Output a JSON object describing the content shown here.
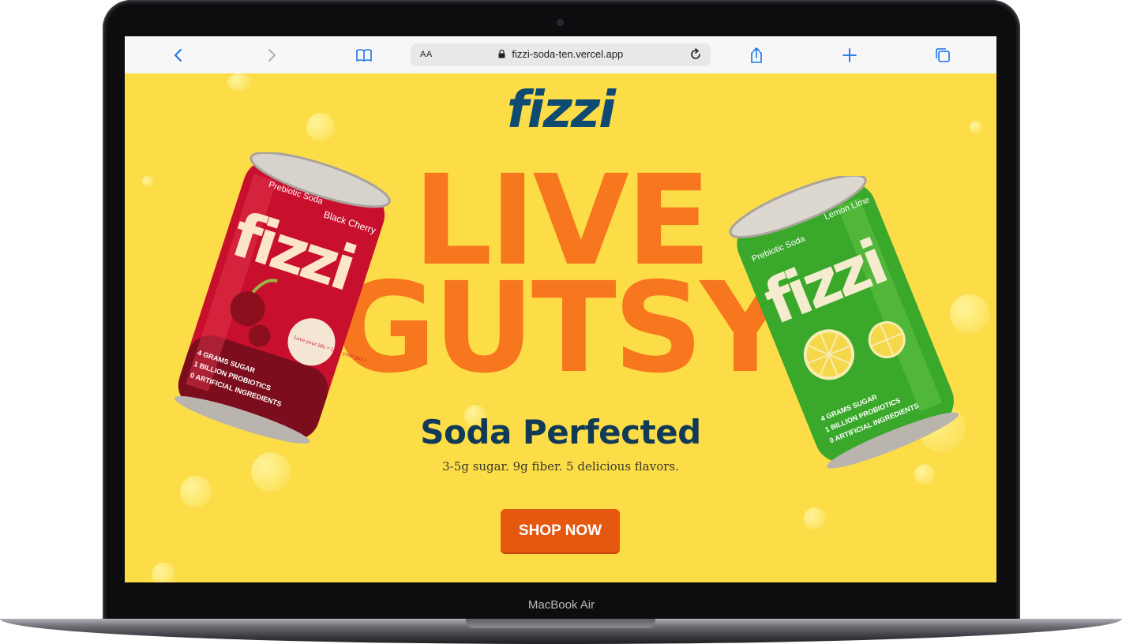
{
  "device": {
    "model_label": "MacBook Air"
  },
  "browser": {
    "text_size_label": "AA",
    "url": "fizzi-soda-ten.vercel.app",
    "icons": [
      "back-icon",
      "forward-icon",
      "bookmarks-icon",
      "lock-icon",
      "reload-icon",
      "share-icon",
      "new-tab-icon",
      "tabs-icon"
    ]
  },
  "hero": {
    "logo": "fizzi",
    "headline_line1": "LIVE",
    "headline_line2": "GUTSY",
    "subtitle": "Soda Perfected",
    "tagline": "3-5g sugar. 9g fiber. 5 delicious flavors.",
    "cta": "SHOP NOW"
  },
  "cans": {
    "left": {
      "brand": "fizzi",
      "label": "Prebiotic Soda",
      "flavor": "Black Cherry",
      "stamp": "Love your life • Love your gut •",
      "stats": [
        "4 GRAMS SUGAR",
        "1 BILLION PROBIOTICS",
        "0 ARTIFICIAL INGREDIENTS"
      ]
    },
    "right": {
      "brand": "fizzi",
      "label": "Prebiotic Soda",
      "flavor": "Lemon Lime",
      "stats": [
        "4 GRAMS SUGAR",
        "1 BILLION PROBIOTICS",
        "0 ARTIFICIAL INGREDIENTS"
      ]
    }
  },
  "colors": {
    "background": "#fcdd48",
    "headline": "#f7771e",
    "logo": "#0f4a72",
    "subtitle": "#103a55",
    "cta": "#e5580f",
    "can_left": "#c8102e",
    "can_right": "#3aa82a"
  }
}
